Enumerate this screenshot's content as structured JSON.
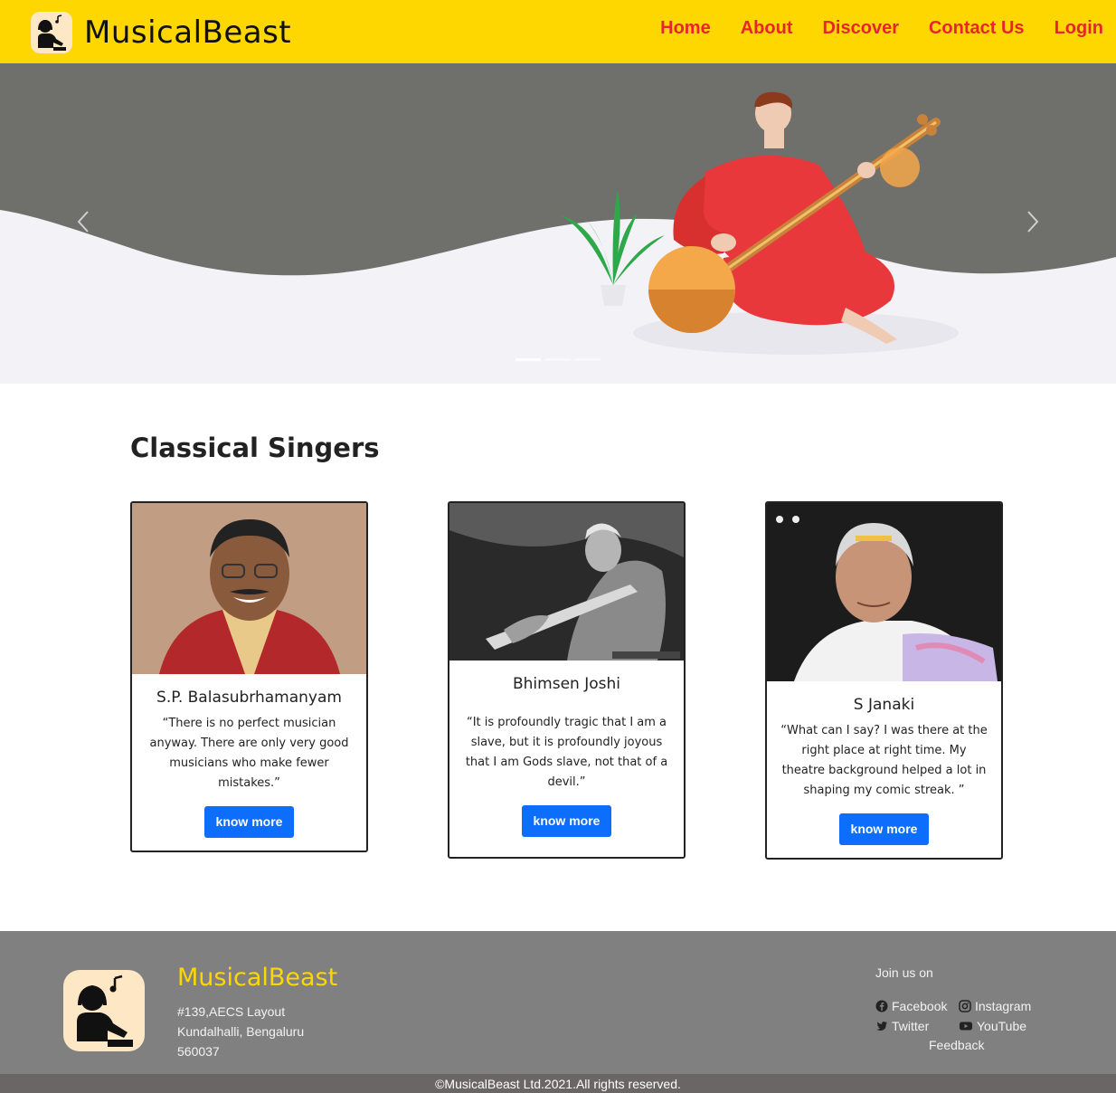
{
  "header": {
    "brand": "MusicalBeast",
    "nav": [
      "Home",
      "About",
      "Discover",
      "Contact Us",
      "Login"
    ]
  },
  "carousel": {
    "slide_count": 3,
    "active_index": 0
  },
  "section": {
    "title": "Classical Singers"
  },
  "cards": [
    {
      "name": "S.P. Balasubrhamanyam",
      "quote": "“There is no perfect musician anyway. There are only very good musicians who make fewer mistakes.”",
      "button": "know more"
    },
    {
      "name": "Bhimsen Joshi",
      "quote": "“It is profoundly tragic that I am a slave, but it is profoundly joyous that I am Gods slave, not that of a devil.”",
      "button": "know more"
    },
    {
      "name": "S Janaki",
      "quote": "“What can I say? I was there at the right place at right time. My theatre background helped a lot in shaping my comic streak. ”",
      "button": "know more"
    }
  ],
  "footer": {
    "brand": "MusicalBeast",
    "address": [
      "#139,AECS Layout",
      "Kundalhalli, Bengaluru",
      "560037"
    ],
    "join": "Join us on",
    "social": [
      "Facebook",
      "Instagram",
      "Twitter",
      "YouTube"
    ],
    "feedback": "Feedback",
    "copyright": "©MusicalBeast Ltd.2021.All rights reserved."
  },
  "colors": {
    "header_bg": "#ffd700",
    "nav_link": "#e8242c",
    "button": "#0d6efd",
    "footer_bg": "#808080",
    "footer_brand": "#ffd700"
  },
  "icons": [
    "musician-logo-icon",
    "chevron-left-icon",
    "chevron-right-icon",
    "facebook-icon",
    "instagram-icon",
    "twitter-icon",
    "youtube-icon"
  ]
}
